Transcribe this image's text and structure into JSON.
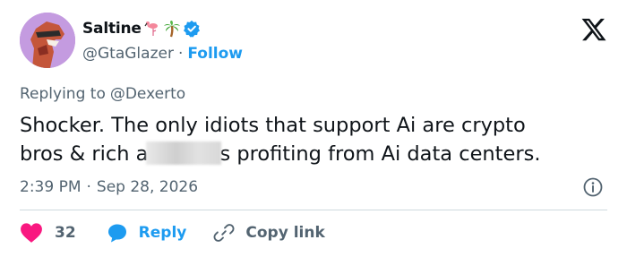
{
  "user": {
    "display_name": "Saltine",
    "handle": "@GtaGlazer",
    "separator": "·",
    "follow_label": "Follow",
    "emojis": [
      "flamingo",
      "palm-tree"
    ],
    "verified": true
  },
  "tweet": {
    "reply_prefix": "Replying to",
    "reply_mention": "@Dexerto",
    "text_line1": "Shocker. The only idiots that support Ai are crypto",
    "text_line2_before": "bros & rich a",
    "text_line2_after": "s profiting from Ai data centers.",
    "time": "2:39 PM",
    "date_separator": "·",
    "date": "Sep 28, 2026"
  },
  "actions": {
    "like_count": "32",
    "reply_label": "Reply",
    "copy_label": "Copy link"
  },
  "colors": {
    "accent": "#1d9bf0",
    "like": "#f91880",
    "muted": "#536471",
    "text": "#0f1419",
    "divider": "#cfd9de"
  }
}
